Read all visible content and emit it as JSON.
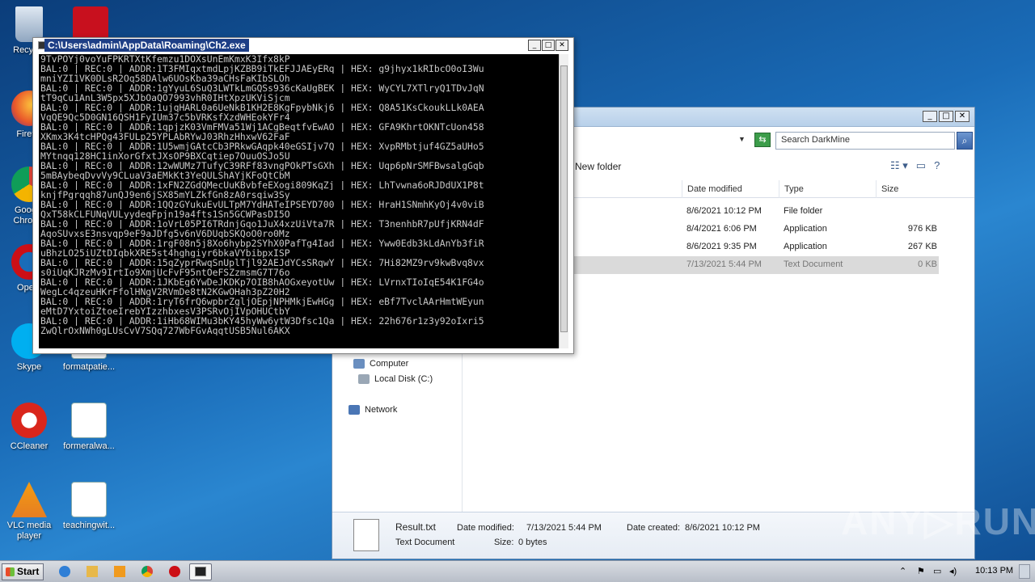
{
  "desktop": {
    "icons": [
      {
        "label": "Recyc..."
      },
      {
        "label": "Firef..."
      },
      {
        "label": "Goog... Chrome"
      },
      {
        "label": "Ope..."
      },
      {
        "label": "Skype"
      },
      {
        "label": "formatpatie..."
      },
      {
        "label": "CCleaner"
      },
      {
        "label": "formeralwa..."
      },
      {
        "label": "VLC media player"
      },
      {
        "label": "teachingwit..."
      }
    ]
  },
  "explorer": {
    "search_placeholder": "Search DarkMine",
    "toolbar": {
      "new_folder": "New folder"
    },
    "columns": {
      "date_modified": "Date modified",
      "type": "Type",
      "size": "Size"
    },
    "files": [
      {
        "date": "8/6/2021 10:12 PM",
        "type": "File folder",
        "size": ""
      },
      {
        "date": "8/4/2021 6:06 PM",
        "type": "Application",
        "size": "976 KB"
      },
      {
        "date": "8/6/2021 9:35 PM",
        "type": "Application",
        "size": "267 KB"
      },
      {
        "date": "7/13/2021 5:44 PM",
        "type": "Text Document",
        "size": "0 KB"
      }
    ],
    "nav": {
      "computer": "Computer",
      "local_disk": "Local Disk (C:)",
      "network": "Network"
    },
    "details": {
      "name": "Result.txt",
      "type": "Text Document",
      "modified_label": "Date modified:",
      "modified_value": "7/13/2021 5:44 PM",
      "created_label": "Date created:",
      "created_value": "8/6/2021 10:12 PM",
      "size_label": "Size:",
      "size_value": "0 bytes"
    }
  },
  "console": {
    "title": "C:\\Users\\admin\\AppData\\Roaming\\Ch2.exe",
    "lines": [
      "9TvPOYj0voYuFPKRTXtKfemzu1DOXsUnEmKmxK3Ifx8kP",
      "BAL:0 | REC:0 | ADDR:1T3FMIqxtmdLpjKZBB9iTkEFJJAEyERq | HEX: g9jhyx1kRIbcO0oI3Wu",
      "mniYZI1VK0DLsR2Oq58DAlw6UOsKba39aCHsFaKIbSLOh",
      "BAL:0 | REC:0 | ADDR:1gYyuL6SuQ3LWTkLmGQSs936cKaUgBEK | HEX: WyCYL7XTlryQ1TDvJqN",
      "tT9qCu1AnL3W5px5XJbOaQO7993vhR0IHtXpzUKViSjcm",
      "BAL:0 | REC:0 | ADDR:1ujqHARL0a6UeNkB1KH2E8KgFpybNkj6 | HEX: Q8A51KsCkoukLLk0AEA",
      "VqQE9Qc5D0GN16QSH1FyIUm37c5bVRKsfXzdWHEokYFr4",
      "BAL:0 | REC:0 | ADDR:1qpjzK03VmFMVa51Wj1ACgBeqtfvEwAO | HEX: GFA9KhrtOKNTcUon458",
      "XKmx3K4tcHPQg43FULp25YPLAbRYwJ03RhzHhxwV62FaF",
      "BAL:0 | REC:0 | ADDR:1U5wmjGAtcCb3PRkwGAqpk40eGSIjv7Q | HEX: XvpRMbtjuf4GZ5aUHo5",
      "MYtnqq128HC1inXorGfxtJXsOP9BXCqtiep7OuuOSJo5U",
      "BAL:0 | REC:0 | ADDR:12wWUMz7TufyC39RFf83vngPOkPTsGXh | HEX: Uqp6pNrSMFBwsalgGqb",
      "5mBAybeqDvvVy9CLuaV3aEMkKt3YeQULShAYjKFoQtCbM",
      "BAL:0 | REC:0 | ADDR:1xFN2ZGdQMecUuKBvbfeEXogi809KqZj | HEX: LhTvwna6oRJDdUX1P8t",
      "knjfPgrqqh87unQJ9en6jSX85mYLZkfGn8zA0rsqiw3Sy",
      "BAL:0 | REC:0 | ADDR:1QQzGYukuEvULTpM7YdHATeIPSEYD700 | HEX: HraH1SNmhKyOj4v0viB",
      "QxT58kCLFUNqVULyydeqFpjn19a4fts1Sn5GCWPasDI5O",
      "BAL:0 | REC:0 | ADDR:1oVrL05PI6TRdnjGqo1JuX4xzUiVta7R | HEX: T3nenhbR7pUfjKRN4dF",
      "AqoSUvxsE3nsvqp9eF9aJDfg5v6nV6DUqbSKQoO0ro0Mz",
      "BAL:0 | REC:0 | ADDR:1rgF08n5j8Xo6hybp2SYhX0PafTg4Iad | HEX: Yww0Edb3kLdAnYb3fiR",
      "uBhzLO25iUZtDIqbkXRE5st4hghgiyr6bkaVYbibpxISP",
      "BAL:0 | REC:0 | ADDR:15qZyprRwqSnUplTjl92AEJdYCsSRqwY | HEX: 7Hi82MZ9rv9kwBvq8vx",
      "s0iUqKJRzMv9IrtIo9XmjUcFvF95ntOeFSZzmsmG7T76o",
      "BAL:0 | REC:0 | ADDR:1JKbEg6YwDeJKDKp7OIB8hAOGxeyotUw | HEX: LVrnxTIoIqE54K1FG4o",
      "WegLc4qzeuHKrFfolHNgV2RVmDe8tN2KGwOHah3pZ20H2",
      "BAL:0 | REC:0 | ADDR:1ryT6frQ6wpbrZgljOEpjNPHMkjEwHGg | HEX: eBf7TvclAArHmtWEyun",
      "eMtD7YxtoiZtoeIrebYIzzhbxesV3PSRvOjIVpOHUCtbY",
      "BAL:0 | REC:0 | ADDR:1iHb68WIMu3bKY45hyWw6ytW3Dfsc1Qa | HEX: 22h676r1z3y92oIxri5",
      "ZwQlrOxNWh0gLUsCvV7SQq727WbFGvAqqtUSB5Nul6AKX"
    ]
  },
  "taskbar": {
    "start": "Start",
    "clock": "10:13 PM"
  },
  "watermark": "ANY▷RUN"
}
